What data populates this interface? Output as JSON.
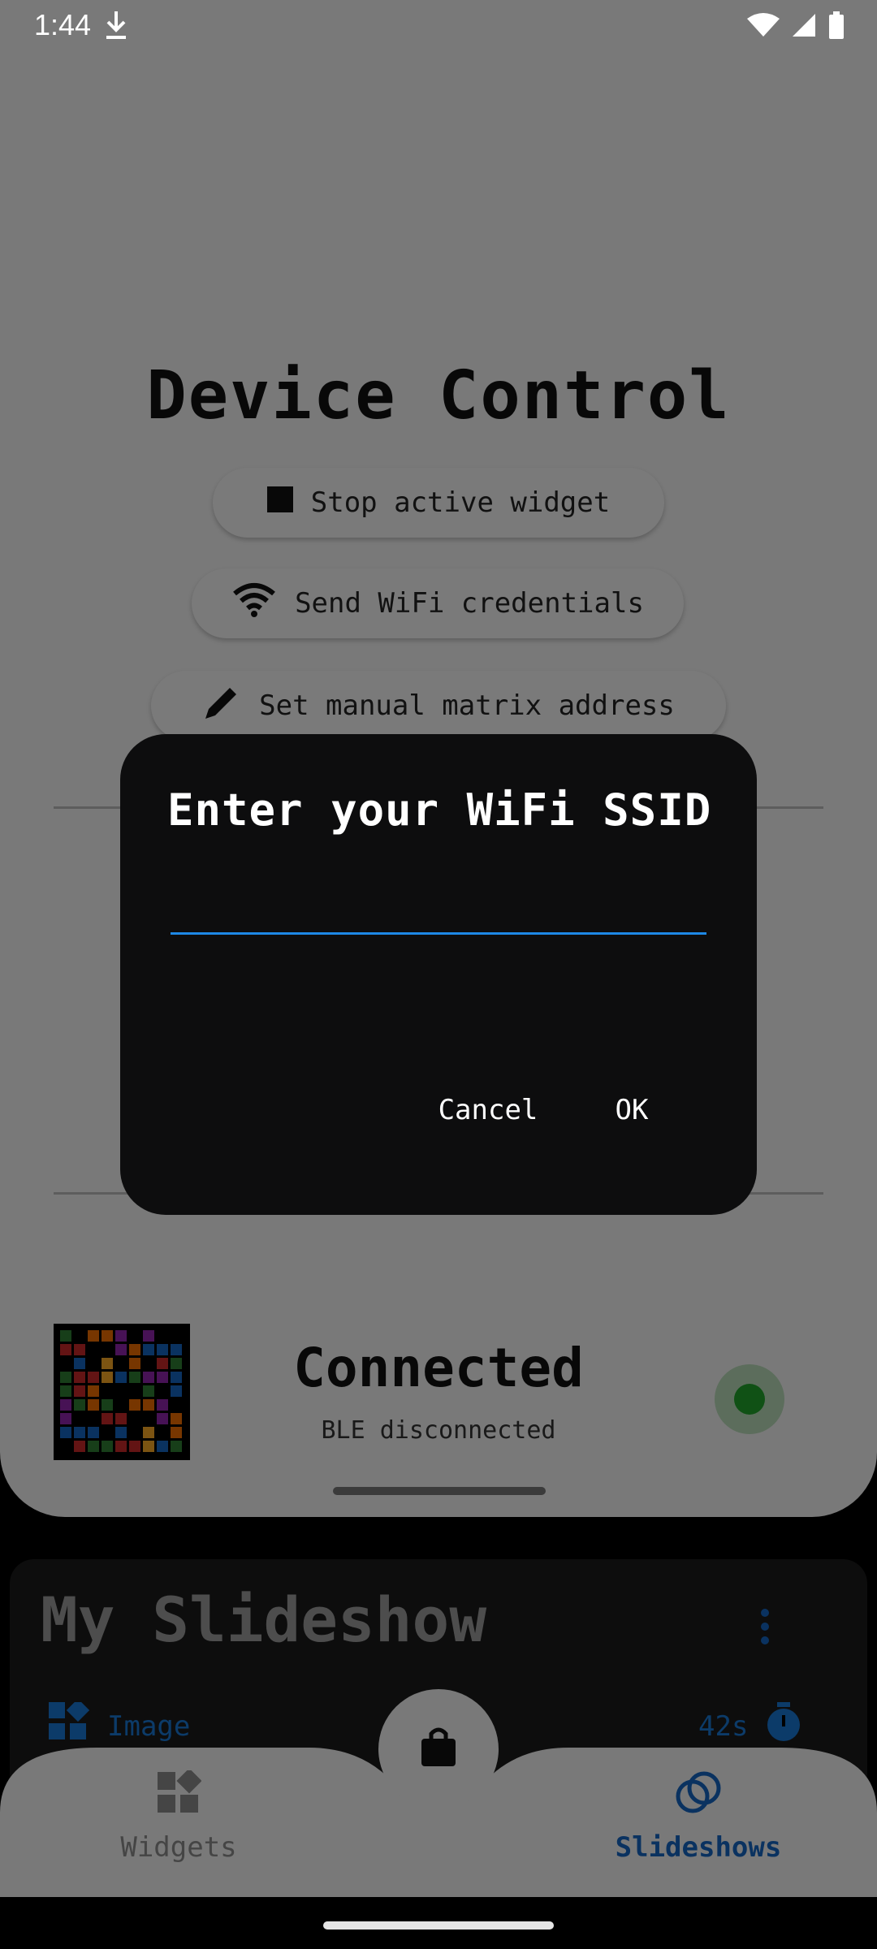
{
  "status_bar": {
    "time": "1:44"
  },
  "page": {
    "title": "Device Control",
    "buttons": [
      {
        "label": "Stop active widget"
      },
      {
        "label": "Send WiFi credentials"
      },
      {
        "label": "Set manual matrix address"
      }
    ]
  },
  "device": {
    "status": "Connected",
    "ble_status": "BLE disconnected",
    "indicator_color": "#21a32a"
  },
  "slideshow": {
    "title": "My Slideshow",
    "item_label": "Image",
    "item_duration": "42s"
  },
  "bottom_nav": {
    "items": [
      {
        "label": "Widgets"
      },
      {
        "label": "Slideshows"
      }
    ]
  },
  "dialog": {
    "title": "Enter your WiFi SSID",
    "input_value": "",
    "cancel_label": "Cancel",
    "ok_label": "OK"
  },
  "colors": {
    "accent": "#1e88e5",
    "dialog_bg": "#0d0d0e",
    "sheet_bg": "#f2f2f2"
  }
}
